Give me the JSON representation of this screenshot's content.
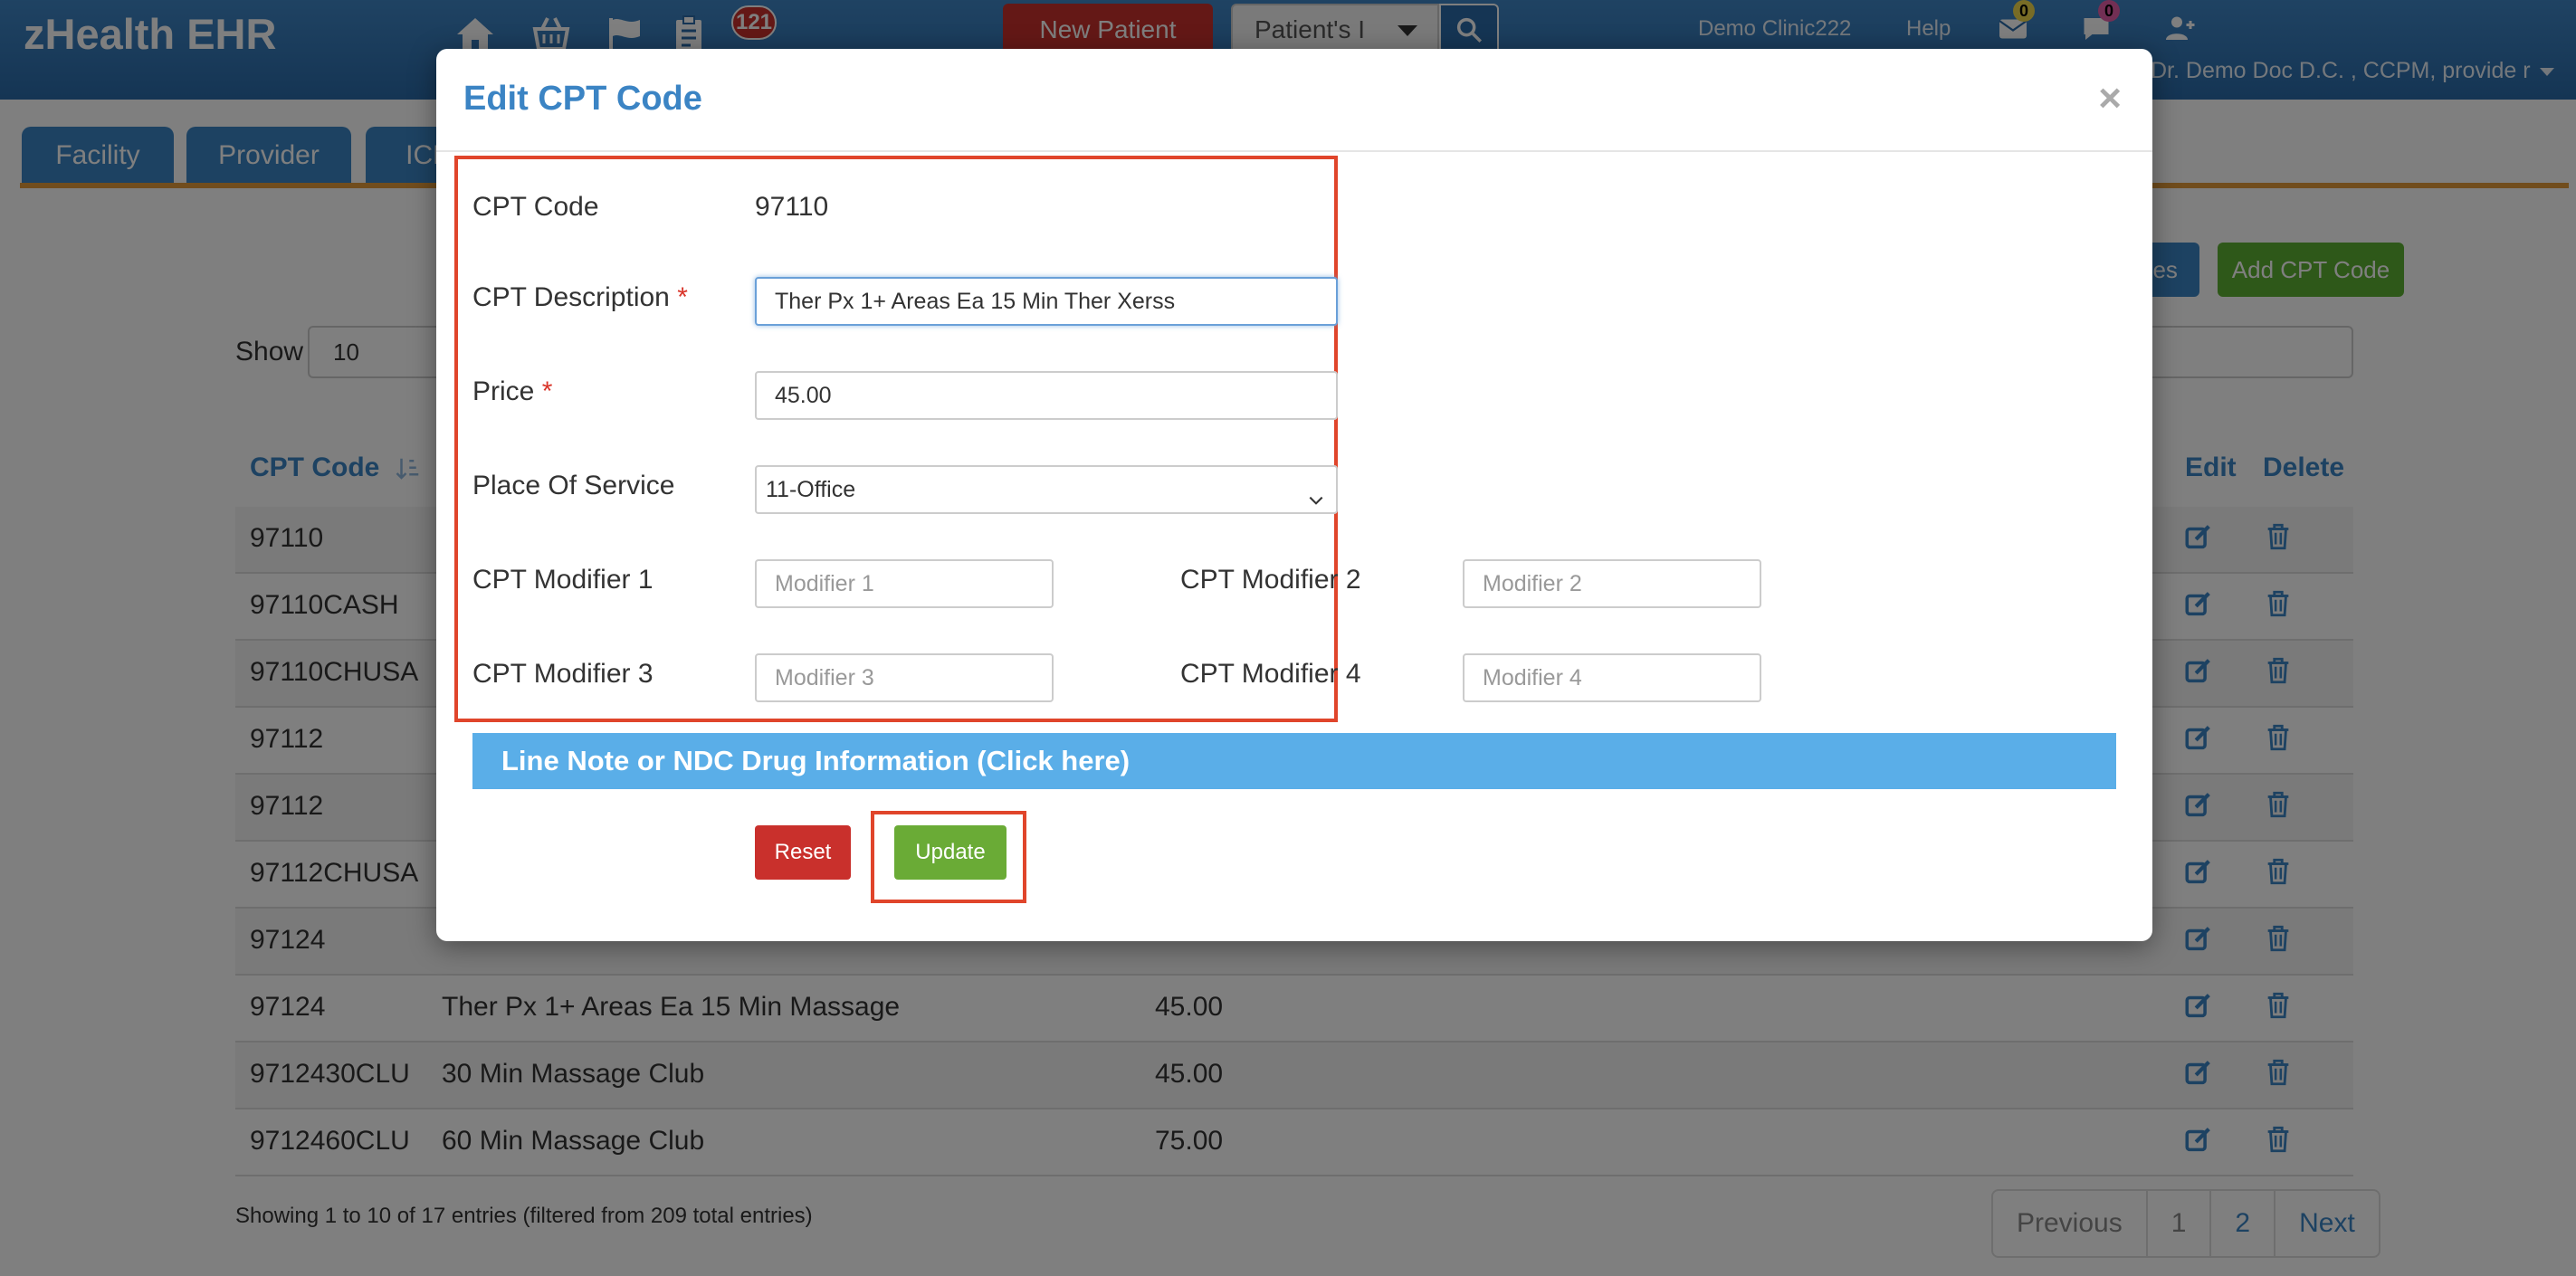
{
  "app": {
    "brand": "zHealth EHR",
    "notification_count": "121",
    "new_patient_label": "New Patient",
    "patient_select_value": "Patient's I",
    "clinic_name": "Demo Clinic222",
    "help_label": "Help",
    "mail_count": "0",
    "chat_count": "0",
    "user_name": "Dr. Demo Doc D.C. , CCPM, provide r"
  },
  "tabs": [
    {
      "label": "Facility"
    },
    {
      "label": "Provider"
    },
    {
      "label": "ICD"
    }
  ],
  "toolbar": {
    "codes_label": "des",
    "add_cpt_label": "Add CPT Code"
  },
  "list_controls": {
    "show_label": "Show",
    "show_value": "10"
  },
  "table": {
    "headers": {
      "code": "CPT Code",
      "edit": "Edit",
      "delete": "Delete"
    },
    "rows": [
      {
        "code": "97110",
        "description": "",
        "price": ""
      },
      {
        "code": "97110CASH",
        "description": "",
        "price": ""
      },
      {
        "code": "97110CHUSA",
        "description": "",
        "price": ""
      },
      {
        "code": "97112",
        "description": "",
        "price": ""
      },
      {
        "code": "97112",
        "description": "",
        "price": ""
      },
      {
        "code": "97112CHUSA",
        "description": "",
        "price": ""
      },
      {
        "code": "97124",
        "description": "",
        "price": ""
      },
      {
        "code": "97124",
        "description": "Ther Px 1+ Areas Ea 15 Min Massage",
        "price": "45.00"
      },
      {
        "code": "9712430CLU",
        "description": "30 Min Massage Club",
        "price": "45.00"
      },
      {
        "code": "9712460CLU",
        "description": "60 Min Massage Club",
        "price": "75.00"
      }
    ],
    "info": "Showing 1 to 10 of 17 entries (filtered from 209 total entries)"
  },
  "pagination": {
    "previous": "Previous",
    "page1": "1",
    "page2": "2",
    "next": "Next"
  },
  "modal": {
    "title": "Edit CPT Code",
    "close": "×",
    "cpt_code_label": "CPT Code",
    "cpt_code_value": "97110",
    "description_label": "CPT Description",
    "description_value": "Ther Px 1+ Areas Ea 15 Min Ther Xerss",
    "price_label": "Price",
    "price_value": "45.00",
    "pos_label": "Place Of Service",
    "pos_value": "11-Office",
    "modifier1_label": "CPT Modifier 1",
    "modifier1_placeholder": "Modifier 1",
    "modifier2_label": "CPT Modifier 2",
    "modifier2_placeholder": "Modifier 2",
    "modifier3_label": "CPT Modifier 3",
    "modifier3_placeholder": "Modifier 3",
    "modifier4_label": "CPT Modifier 4",
    "modifier4_placeholder": "Modifier 4",
    "required_mark": "*",
    "line_note_label": "Line Note or NDC Drug Information (Click here)",
    "reset_label": "Reset",
    "update_label": "Update"
  },
  "colors": {
    "navbar": "#3f86c6",
    "primary": "#3b84c4",
    "danger": "#c9302c",
    "success": "#6aab36",
    "highlight": "#e0452b",
    "line_note": "#5aaee8"
  }
}
